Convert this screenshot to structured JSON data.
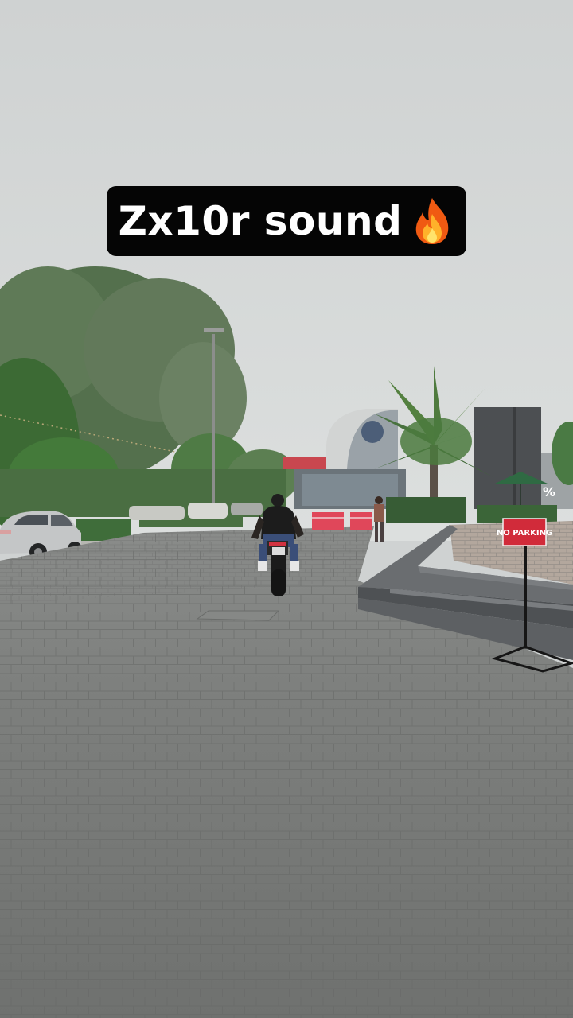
{
  "caption": {
    "text": "Zx10r sound",
    "emoji_icon": "fire-icon"
  },
  "signs": {
    "no_parking": "NO PARKING",
    "storefront_partial": "%"
  },
  "colors": {
    "sky": "#d3d6d6",
    "pavement": "#7e807e",
    "caption_bg": "#050505",
    "caption_text": "#ffffff",
    "sign_red": "#d12b3a",
    "barrier_red": "#e0475a",
    "foliage": "#3f6d3a"
  }
}
